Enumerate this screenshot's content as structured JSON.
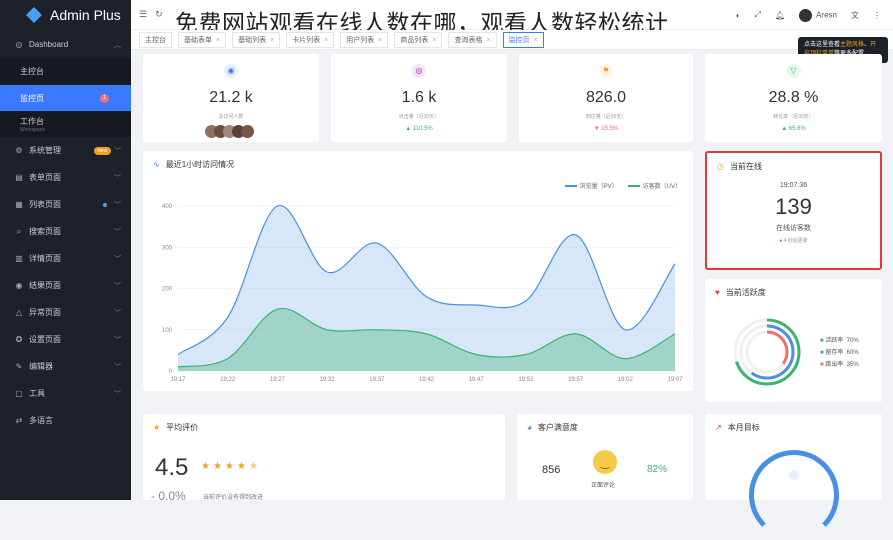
{
  "overlay_title": "免费网站观看在线人数在哪，观看人数轻松统计",
  "app": {
    "name": "Admin Plus"
  },
  "sidebar": {
    "dashboard": "Dashboard",
    "sub_items": [
      {
        "label": "主控台"
      },
      {
        "label": "监控页",
        "badge": "1"
      }
    ],
    "workspace": {
      "label": "工作台",
      "sub": "Workspace"
    },
    "items": [
      {
        "label": "系统管理",
        "badge": "new"
      },
      {
        "label": "表单页面"
      },
      {
        "label": "列表页面"
      },
      {
        "label": "搜索页面"
      },
      {
        "label": "详情页面"
      },
      {
        "label": "结果页面"
      },
      {
        "label": "异常页面"
      },
      {
        "label": "设置页面"
      },
      {
        "label": "编辑器"
      },
      {
        "label": "工具"
      },
      {
        "label": "多语言"
      }
    ]
  },
  "topbar": {
    "username": "Aresn"
  },
  "tabs": [
    "主控台",
    "基础表单",
    "基础列表",
    "卡片列表",
    "用户列表",
    "商品列表",
    "查询表格",
    "监控页"
  ],
  "tooltip": {
    "text1": "点击这里查看",
    "hl1": "主题风格",
    "text2": "、",
    "hl2": "开启顶栏菜单",
    "text3": "等更多配置"
  },
  "stats": [
    {
      "value": "21.2 k",
      "label": "总访问人数",
      "trend": "",
      "dir": "",
      "color": "#3a7afe",
      "icon": "eye-icon"
    },
    {
      "value": "1.6 k",
      "label": "点击量（近30天）",
      "trend": "110.5%",
      "dir": "up",
      "color": "#9c27b0",
      "icon": "target-icon"
    },
    {
      "value": "826.0",
      "label": "到达量（近30天）",
      "trend": "15.5%",
      "dir": "down",
      "color": "#f0a020",
      "icon": "flag-icon"
    },
    {
      "value": "28.8 %",
      "label": "转化率（近30天）",
      "trend": "65.8%",
      "dir": "up",
      "color": "#3cb371",
      "icon": "funnel-icon"
    }
  ],
  "visit_chart": {
    "title": "最近1小时访问情况",
    "legend_pv": "浏览量（PV）",
    "legend_uv": "访客数（UV）"
  },
  "chart_data": {
    "type": "area",
    "x": [
      "19:17",
      "19:22",
      "19:27",
      "19:32",
      "19:37",
      "19:42",
      "19:47",
      "19:52",
      "19:57",
      "19:02",
      "19:07"
    ],
    "ylim": [
      0,
      400
    ],
    "yticks": [
      0,
      100,
      200,
      300,
      400
    ],
    "series": [
      {
        "name": "浏览量（PV）",
        "values": [
          40,
          130,
          400,
          240,
          310,
          180,
          160,
          170,
          330,
          100,
          260
        ],
        "color": "#4a90e2"
      },
      {
        "name": "访客数（UV）",
        "values": [
          10,
          30,
          150,
          100,
          100,
          90,
          40,
          40,
          90,
          30,
          90
        ],
        "color": "#3cb371"
      }
    ]
  },
  "online": {
    "title": "当前在线",
    "time": "19:07:36",
    "count": "139",
    "label": "在线访客数",
    "footer": "4 秒后更新"
  },
  "activity": {
    "title": "当前活跃度",
    "items": [
      {
        "label": "活跃率",
        "value": "70%",
        "color": "#3cb371",
        "fraction": 0.7
      },
      {
        "label": "留存率",
        "value": "60%",
        "color": "#4a90e2",
        "fraction": 0.6
      },
      {
        "label": "跳出率",
        "value": "35%",
        "color": "#f56c6c",
        "fraction": 0.35
      }
    ]
  },
  "rating": {
    "title": "平均评价",
    "value": "4.5",
    "stars": 4.5,
    "footnote": "当前评价没有得到改进",
    "trend": "0.0%"
  },
  "satisfaction": {
    "title": "客户满意度",
    "left": "856",
    "right": "82%",
    "label": "正面评论"
  },
  "goal": {
    "title": "本月目标"
  }
}
